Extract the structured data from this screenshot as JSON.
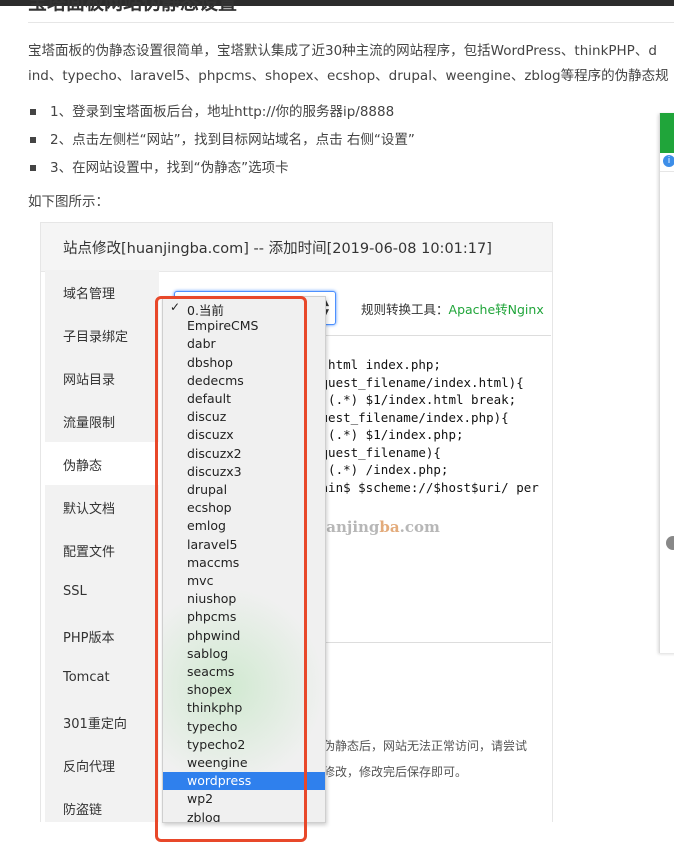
{
  "article": {
    "heading": "宝塔面板网站伪静态设置",
    "intro_line1": "宝塔面板的伪静态设置很简单，宝塔默认集成了近30种主流的网站程序，包括WordPress、thinkPHP、d",
    "intro_line2": "ind、typecho、laravel5、phpcms、shopex、ecshop、drupal、weengine、zblog等程序的伪静态规",
    "steps": [
      "1、登录到宝塔面板后台，地址http://你的服务器ip/8888",
      "2、点击左侧栏“网站”，找到目标网站域名，点击 右侧“设置”",
      "3、在网站设置中，找到“伪静态”选项卡"
    ],
    "caption": "如下图所示："
  },
  "dialog": {
    "title": "站点修改[huanjingba.com] -- 添加时间[2019-06-08 10:01:17]",
    "sidebar": [
      "域名管理",
      "子目录绑定",
      "网站目录",
      "流量限制",
      "伪静态",
      "默认文档",
      "配置文件",
      "SSL",
      "PHP版本",
      "Tomcat",
      "301重定向",
      "反向代理",
      "防盗链"
    ],
    "active_item": "伪静态",
    "toolbar_label": "规则转换工具：",
    "toolbar_link": "Apache转Nginx",
    "code_lines": [
      "x.html index.php;",
      "equest_filename/index.html){",
      "e (.*) $1/index.html break;",
      "",
      "quest_filename/index.php){",
      "e (.*) $1/index.php;",
      "",
      "equest_filename){",
      "e (.*) /index.php;",
      "",
      "",
      "",
      "main$ $scheme://$host$uri/ per"
    ],
    "note_line1": "置伪静态后，网站无法正常访问，请尝试",
    "note_line2": "行修改，修改完后保存即可。"
  },
  "dropdown": {
    "selected": "0.当前",
    "highlighted": "wordpress",
    "options": [
      "0.当前",
      "EmpireCMS",
      "dabr",
      "dbshop",
      "dedecms",
      "default",
      "discuz",
      "discuzx",
      "discuzx2",
      "discuzx3",
      "drupal",
      "ecshop",
      "emlog",
      "laravel5",
      "maccms",
      "mvc",
      "niushop",
      "phpcms",
      "phpwind",
      "sablog",
      "seacms",
      "shopex",
      "thinkphp",
      "typecho",
      "typecho2",
      "weengine",
      "wordpress",
      "wp2",
      "zblog"
    ]
  },
  "watermark": {
    "prefix": "www.huanjing",
    "accent": "ba",
    "suffix": ".com"
  },
  "colors": {
    "accent_green": "#20a53a",
    "highlight_blue": "#2f80ed",
    "frame_red": "#e8482a"
  }
}
